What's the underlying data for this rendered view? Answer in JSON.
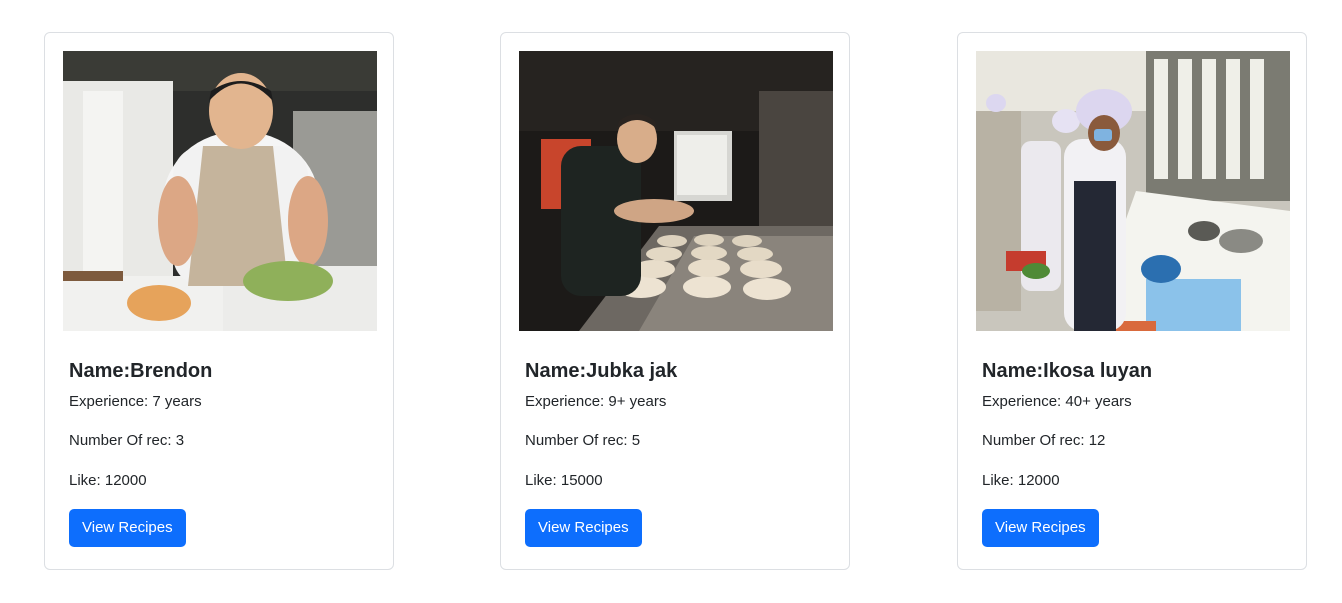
{
  "chefs": [
    {
      "name": "Name:Brendon",
      "experience": "Experience: 7 years",
      "recipes": "Number Of rec: 3",
      "likes": "Like: 12000",
      "button": "View Recipes"
    },
    {
      "name": "Name:Jubka jak",
      "experience": "Experience: 9+ years",
      "recipes": "Number Of rec: 5",
      "likes": "Like: 15000",
      "button": "View Recipes"
    },
    {
      "name": "Name:Ikosa luyan",
      "experience": "Experience: 40+ years",
      "recipes": "Number Of rec: 12",
      "likes": "Like: 12000",
      "button": "View Recipes"
    }
  ],
  "colors": {
    "button_bg": "#0d6efd",
    "button_text": "#ffffff",
    "card_border": "#dcdfe3"
  }
}
